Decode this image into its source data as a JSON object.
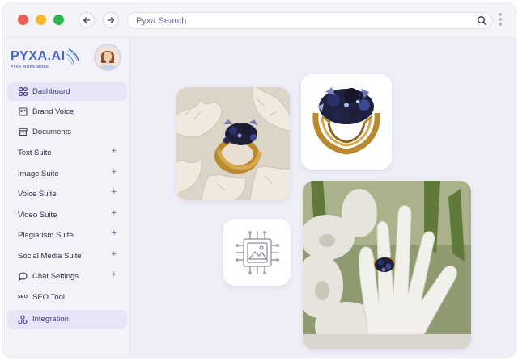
{
  "browser": {
    "search_placeholder": "Pyxa Search"
  },
  "brand": {
    "name": "PYXA.AI",
    "tagline": "PYXA WORK MODE"
  },
  "sidebar": {
    "items": [
      {
        "label": "Dashboard",
        "icon": "grid-icon",
        "active": true
      },
      {
        "label": "Brand Voice",
        "icon": "book-icon"
      },
      {
        "label": "Documents",
        "icon": "archive-icon"
      },
      {
        "label": "Text Suite",
        "expand": "+"
      },
      {
        "label": "Image Suite",
        "expand": "+"
      },
      {
        "label": "Voice Suite",
        "expand": "+"
      },
      {
        "label": "Video Suite",
        "expand": "+"
      },
      {
        "label": "Plagiarism Suite",
        "expand": "+"
      },
      {
        "label": "Social Media Suite",
        "expand": "+"
      },
      {
        "label": "Chat Settings",
        "icon": "chat-icon",
        "expand": "+"
      },
      {
        "label": "SEO Tool",
        "icon_text": "SEO"
      },
      {
        "label": "Integration",
        "icon": "integration-icon",
        "active": true
      }
    ]
  },
  "colors": {
    "accent": "#4a63c8",
    "active_bg": "#e6e4f6",
    "window_bg": "#eeeef7"
  }
}
